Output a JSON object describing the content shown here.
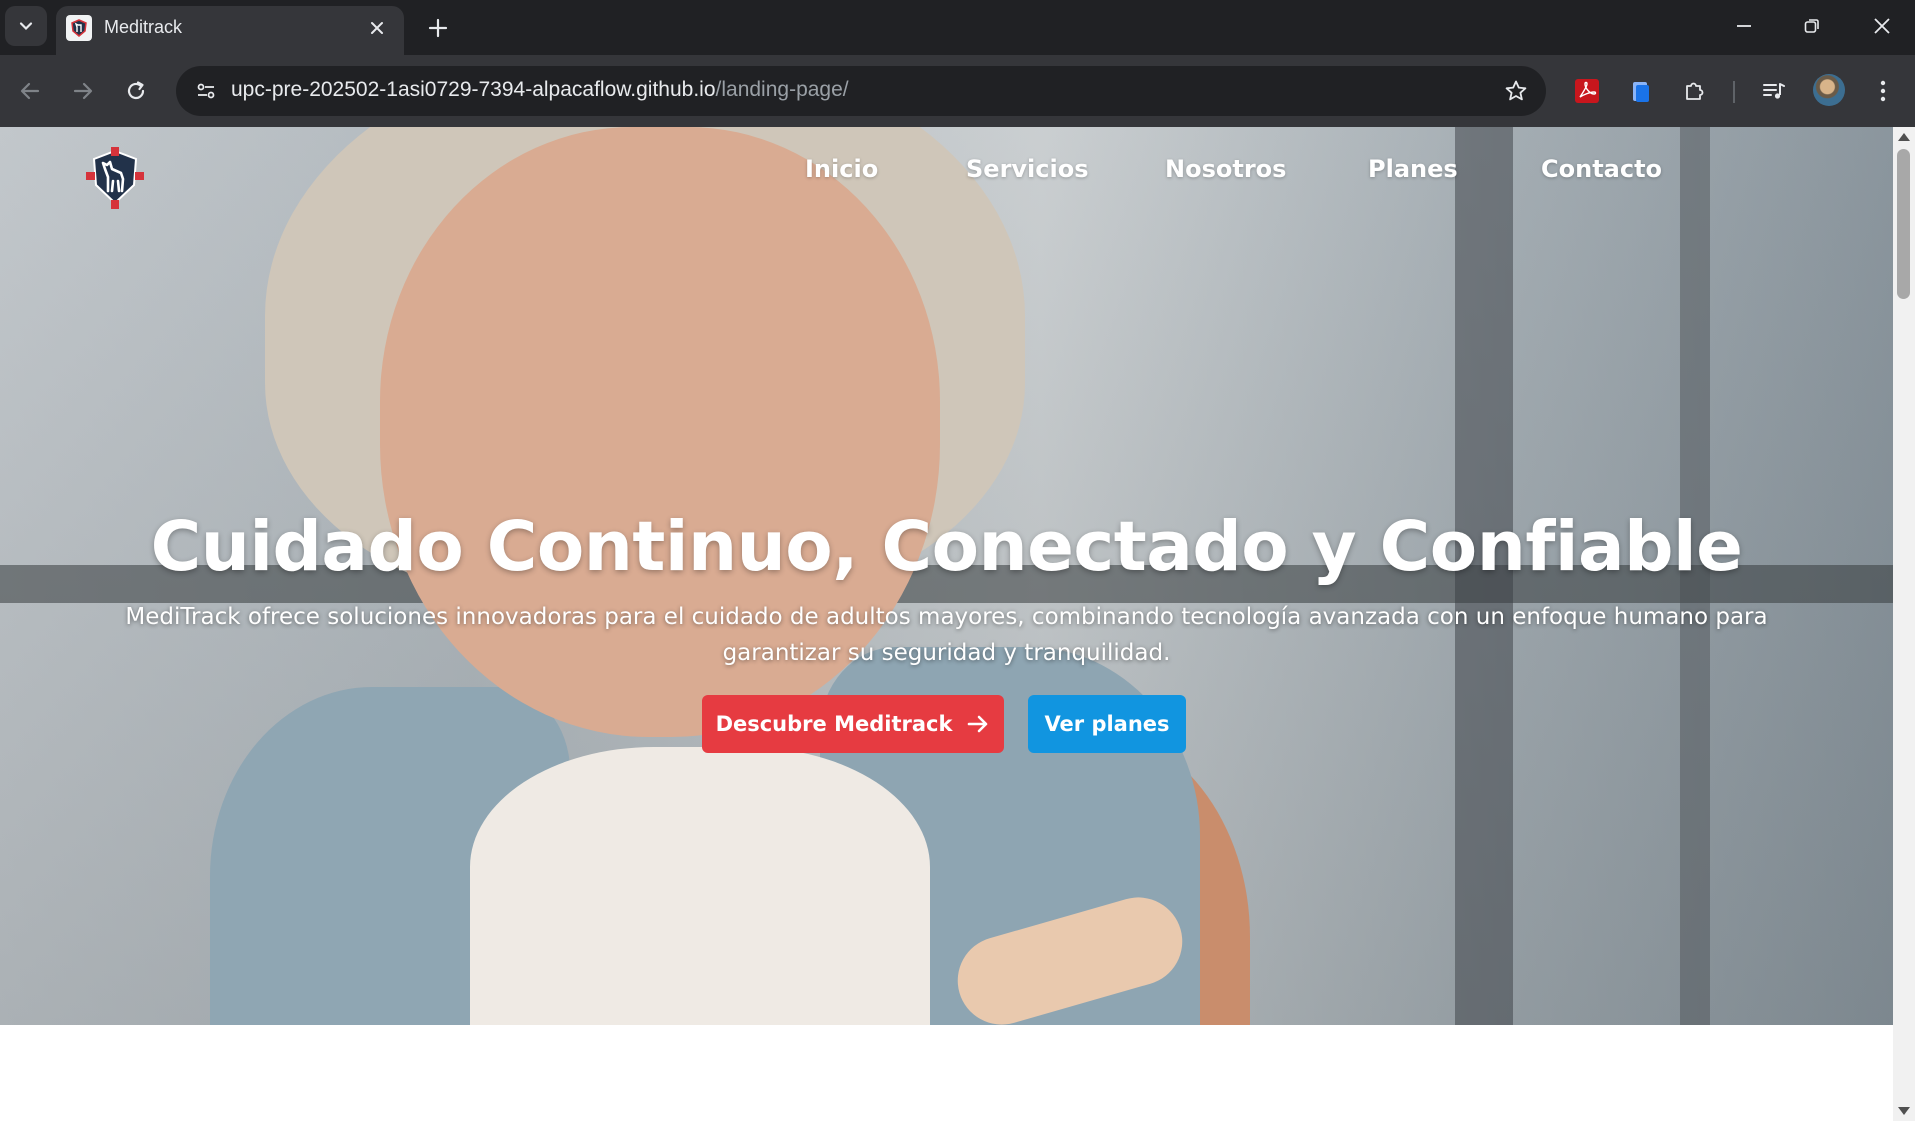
{
  "browser": {
    "tab": {
      "title": "Meditrack"
    },
    "address": {
      "host": "upc-pre-202502-1asi0729-7394-alpacaflow.github.io",
      "path": "/landing-page/"
    },
    "toolbar_icons": [
      "back-icon",
      "forward-icon",
      "reload-icon",
      "site-info-icon",
      "bookmark-star-icon",
      "pdf-extension-icon",
      "clipboard-extension-icon",
      "extensions-puzzle-icon",
      "reading-list-icon",
      "profile-avatar",
      "menu-kebab-icon"
    ],
    "window_controls": [
      "minimize-icon",
      "restore-icon",
      "close-icon"
    ]
  },
  "site": {
    "nav": {
      "inicio": "Inicio",
      "servicios": "Servicios",
      "nosotros": "Nosotros",
      "planes": "Planes",
      "contacto": "Contacto"
    },
    "hero": {
      "title": "Cuidado Continuo, Conectado y Confiable",
      "subtitle": "MediTrack ofrece soluciones innovadoras para el cuidado de adultos mayores, combinando tecnología avanzada con un enfoque humano para garantizar su seguridad y tranquilidad.",
      "primary_button": "Descubre Meditrack",
      "secondary_button": "Ver planes"
    }
  },
  "colors": {
    "browser_frame": "#202124",
    "browser_toolbar": "#35363a",
    "primary_button": "#e63b41",
    "secondary_button": "#1195e0",
    "logo_red": "#d6333b",
    "logo_navy": "#22324a"
  }
}
